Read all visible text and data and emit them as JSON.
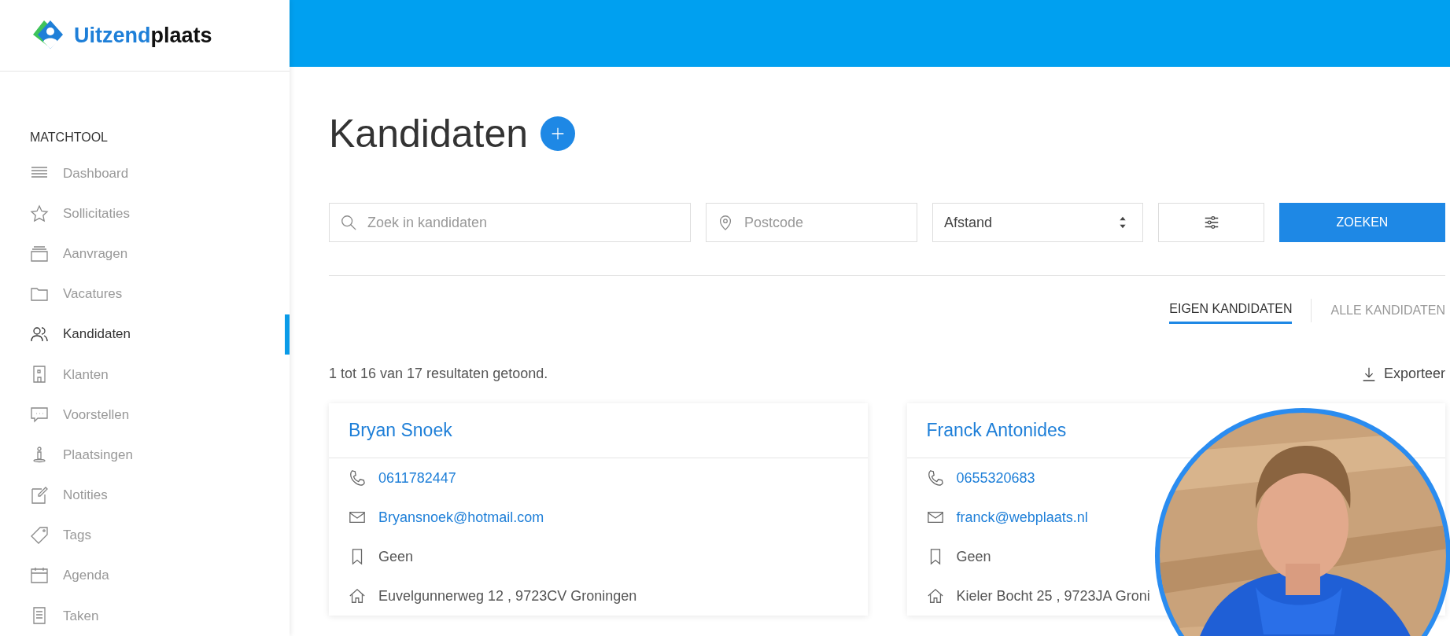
{
  "logo": {
    "brand_first": "Uitzend",
    "brand_second": "plaats"
  },
  "sidebar": {
    "section": "MATCHTOOL",
    "items": [
      {
        "label": "Dashboard",
        "selected": false
      },
      {
        "label": "Sollicitaties",
        "selected": false
      },
      {
        "label": "Aanvragen",
        "selected": false
      },
      {
        "label": "Vacatures",
        "selected": false
      },
      {
        "label": "Kandidaten",
        "selected": true
      },
      {
        "label": "Klanten",
        "selected": false
      },
      {
        "label": "Voorstellen",
        "selected": false
      },
      {
        "label": "Plaatsingen",
        "selected": false
      },
      {
        "label": "Notities",
        "selected": false
      },
      {
        "label": "Tags",
        "selected": false
      },
      {
        "label": "Agenda",
        "selected": false
      },
      {
        "label": "Taken",
        "selected": false
      }
    ]
  },
  "page": {
    "title": "Kandidaten"
  },
  "search": {
    "placeholder": "Zoek in kandidaten"
  },
  "postcode": {
    "placeholder": "Postcode"
  },
  "distance": {
    "value": "Afstand"
  },
  "search_button": "ZOEKEN",
  "tabs": [
    {
      "label": "EIGEN KANDIDATEN",
      "selected": true
    },
    {
      "label": "ALLE KANDIDATEN",
      "selected": false
    }
  ],
  "results_text": "1 tot 16 van 17 resultaten getoond.",
  "export": "Exporteer",
  "cards": [
    {
      "name": "Bryan Snoek",
      "phone": "0611782447",
      "email": "Bryansnoek@hotmail.com",
      "tag": "Geen",
      "address": "Euvelgunnerweg 12 , 9723CV Groningen"
    },
    {
      "name": "Franck Antonides",
      "phone": "0655320683",
      "email": "franck@webplaats.nl",
      "tag": "Geen",
      "address": "Kieler Bocht 25 , 9723JA Groni"
    }
  ]
}
